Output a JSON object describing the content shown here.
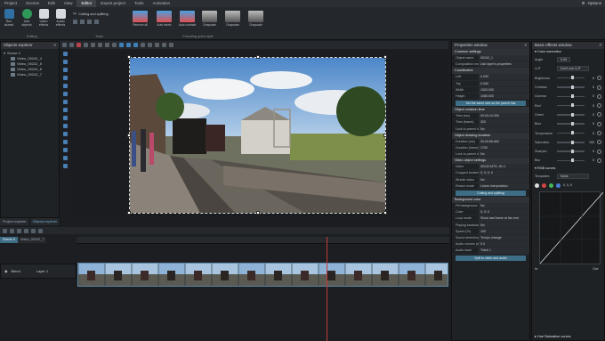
{
  "menu": {
    "items": [
      "Project",
      "Scenes",
      "Edit",
      "View",
      "Editor",
      "Export project",
      "Tools",
      "Activation"
    ],
    "active_index": 4,
    "options_label": "Options"
  },
  "ribbon": {
    "buttons": [
      "Run wizard",
      "Add objects",
      "Video effects",
      "Audio effects"
    ],
    "group_editing": "Editing",
    "cutting_label": "Cutting and splitting",
    "group_tools": "Tools",
    "quick_styles": [
      "Remove all",
      "Auto levels",
      "Auto contrast",
      "Grayscale",
      "Grayscale",
      "Grayscale"
    ],
    "group_quick": "Choosing quick style",
    "accent": "#3a8fd0"
  },
  "objects_explorer": {
    "title": "Objects explorer",
    "root": "Scene 0",
    "items": [
      "Video_00242_4",
      "Video_00242_5",
      "Video_00242_6",
      "Video_00242_7"
    ]
  },
  "bottom_tabs": [
    "Project explorer",
    "Objects explorer"
  ],
  "timeline": {
    "tabs": [
      "Scene 0",
      "Video_00242_7"
    ],
    "tracks": [
      {
        "label": "Blend",
        "layer": "Layer 1"
      }
    ]
  },
  "properties": {
    "title": "Properties window",
    "sections": {
      "common": "Common settings",
      "coordinates": "Coordinates",
      "creation_time": "Object creation time",
      "drawing_duration": "Object drawing duration",
      "video_settings": "Video object settings",
      "background": "Background color"
    },
    "common_rows": [
      {
        "k": "Object name",
        "v": "00242_1"
      },
      {
        "k": "Composition mode",
        "v": "Use layer's properties"
      }
    ],
    "coord_rows": [
      {
        "k": "Left",
        "v": "0.000"
      },
      {
        "k": "Top",
        "v": "0.000"
      },
      {
        "k": "Width",
        "v": "1920.000"
      },
      {
        "k": "Height",
        "v": "1080.000"
      }
    ],
    "coord_button": "Set the same size as the parent has",
    "time_rows": [
      {
        "k": "Time (ms)",
        "v": "00:00:10.000"
      },
      {
        "k": "Time (frame)",
        "v": "300"
      },
      {
        "k": "Lock to parent du",
        "v": "No"
      }
    ],
    "duration_rows": [
      {
        "k": "Duration (ms)",
        "v": "00:00:56.660"
      },
      {
        "k": "Duration (frame)",
        "v": "1700"
      },
      {
        "k": "Lock to parent du",
        "v": "No"
      }
    ],
    "video_rows": [
      {
        "k": "Video",
        "v": "00242.MTS; ID=1"
      },
      {
        "k": "Cropped borders",
        "v": "0; 0; 0; 0"
      },
      {
        "k": "Stretch video",
        "v": "No"
      },
      {
        "k": "Resize mode",
        "v": "Linear interpolation"
      }
    ],
    "video_button": "Cutting and splitting",
    "bg_rows": [
      {
        "k": "Fill background",
        "v": "No"
      },
      {
        "k": "Color",
        "v": "0; 0; 0"
      },
      {
        "k": "Loop mode",
        "v": "Show last frame at the end"
      },
      {
        "k": "Playing backwards",
        "v": "No"
      },
      {
        "k": "Speed (%)",
        "v": "100"
      },
      {
        "k": "Sound stretching m",
        "v": "Tempo change"
      },
      {
        "k": "Audio volume (dB)",
        "v": "0.0"
      },
      {
        "k": "Audio track",
        "v": "Track 1"
      }
    ],
    "bottom_button": "Split to video and audio"
  },
  "effects": {
    "title": "Basic effects window",
    "color_section": "Color correction",
    "angle_label": "Angle",
    "angle_value": "0.00",
    "lut_label": "LUT",
    "lut_value": "Don't use LUT",
    "rows": [
      {
        "label": "Brightness",
        "value": "0"
      },
      {
        "label": "Contrast",
        "value": "0"
      },
      {
        "label": "Gamma",
        "value": "0"
      },
      {
        "label": "Red",
        "value": "0"
      },
      {
        "label": "Green",
        "value": "0"
      },
      {
        "label": "Blue",
        "value": "0"
      },
      {
        "label": "Temperature",
        "value": "0"
      },
      {
        "label": "Saturation",
        "value": "100"
      },
      {
        "label": "Sharpen",
        "value": "0"
      },
      {
        "label": "Blur",
        "value": "0"
      }
    ],
    "rgb_section": "RGB curves",
    "templates_label": "Templates",
    "templates_value": "None",
    "point_readout": "0, 0, 0",
    "curve_in": "In:",
    "curve_out": "Out:",
    "hue_section": "Hue Saturation curves"
  }
}
